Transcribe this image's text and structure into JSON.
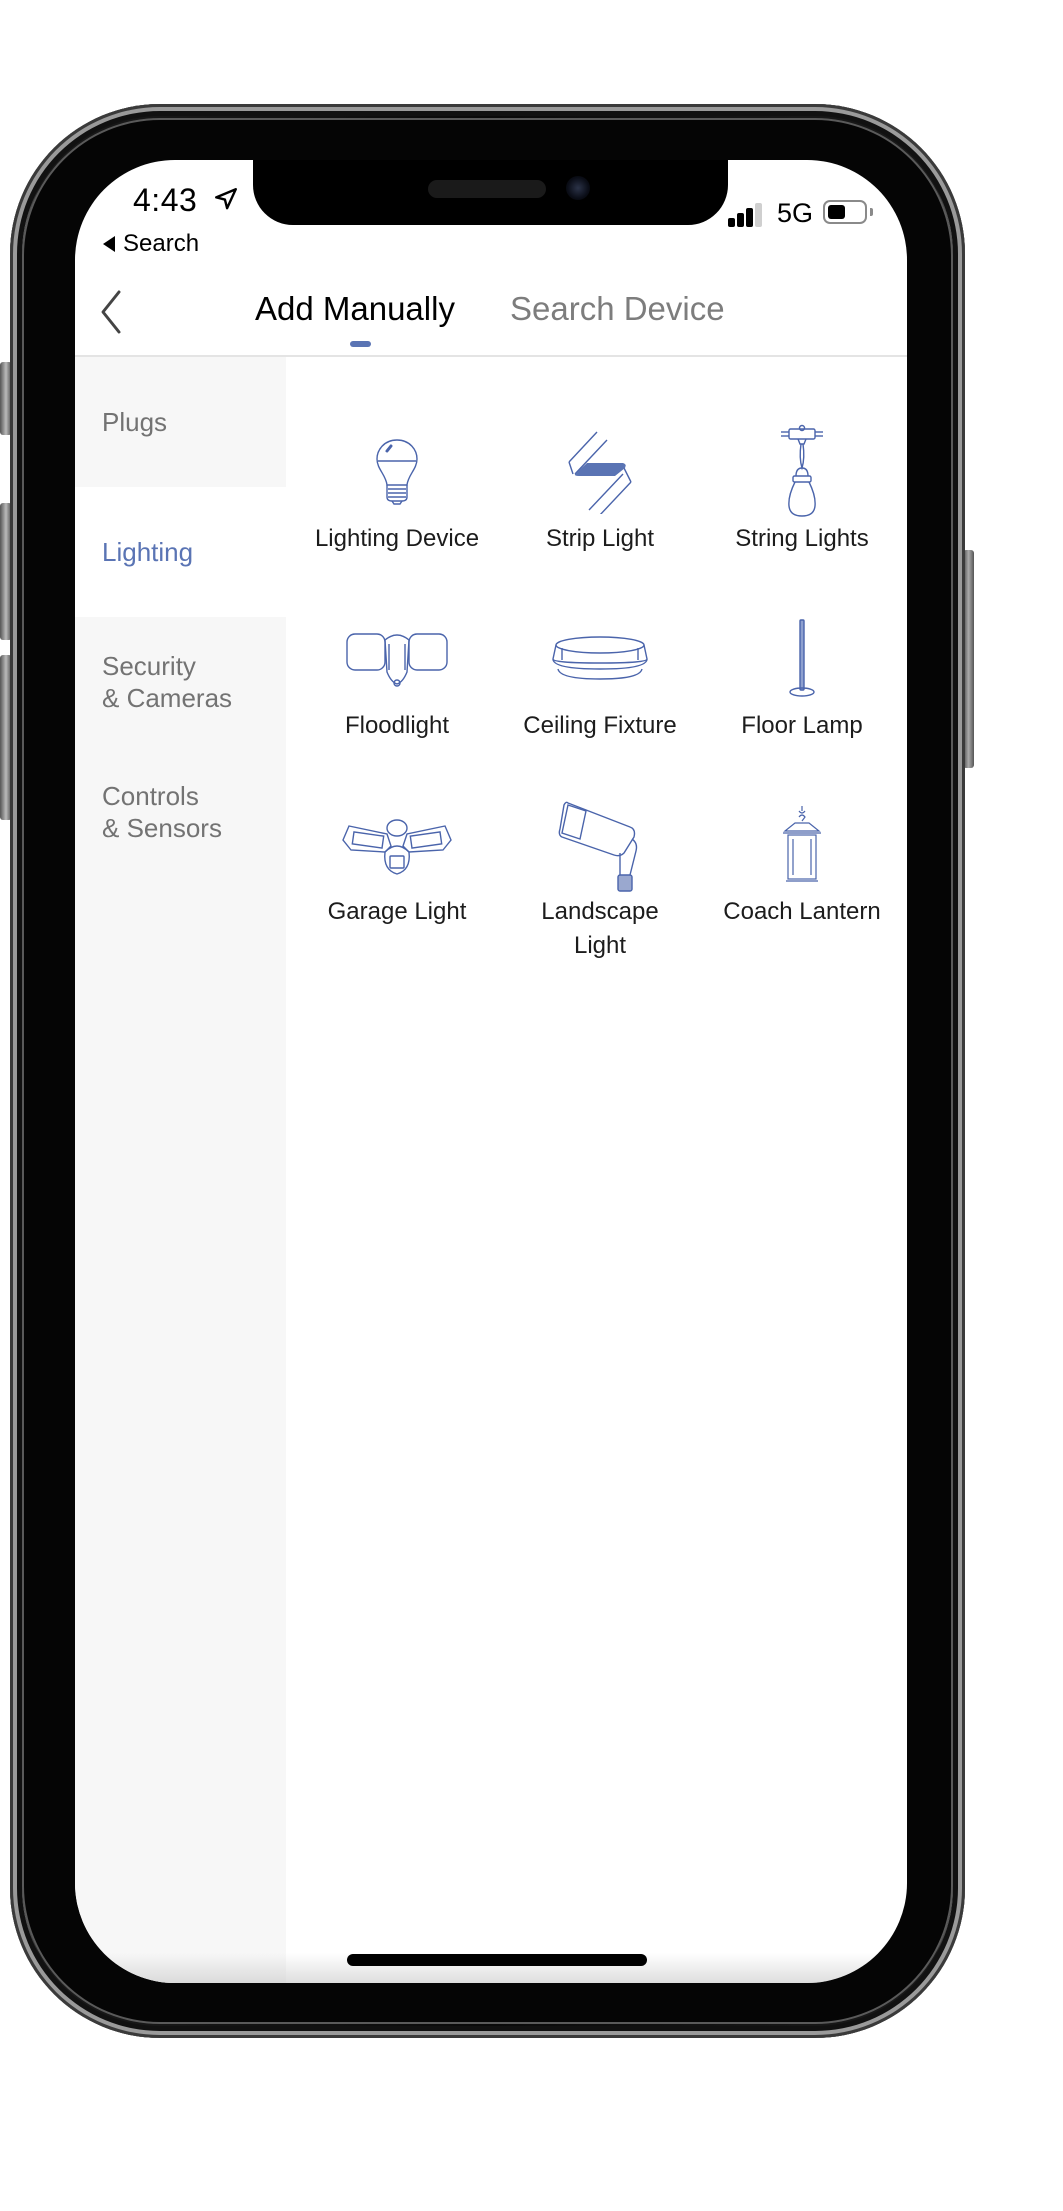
{
  "status_bar": {
    "time": "4:43",
    "back_app_label": "Search",
    "network": "5G",
    "battery_level": 0.5,
    "signal_bars_active": 3,
    "signal_bars_total": 4
  },
  "header": {
    "tabs": [
      {
        "label": "Add Manually",
        "active": true
      },
      {
        "label": "Search Device",
        "active": false
      }
    ]
  },
  "sidebar": {
    "items": [
      {
        "label": "Plugs",
        "active": false
      },
      {
        "label": "Lighting",
        "active": true
      },
      {
        "label": "Security\n& Cameras",
        "active": false
      },
      {
        "label": "Controls\n& Sensors",
        "active": false
      }
    ]
  },
  "devices": [
    {
      "label": "Lighting Device",
      "icon": "light-bulb-icon"
    },
    {
      "label": "Strip Light",
      "icon": "strip-light-icon"
    },
    {
      "label": "String Lights",
      "icon": "string-lights-icon"
    },
    {
      "label": "Floodlight",
      "icon": "floodlight-icon"
    },
    {
      "label": "Ceiling Fixture",
      "icon": "ceiling-fixture-icon"
    },
    {
      "label": "Floor Lamp",
      "icon": "floor-lamp-icon"
    },
    {
      "label": "Garage Light",
      "icon": "garage-light-icon"
    },
    {
      "label": "Landscape\nLight",
      "icon": "landscape-light-icon"
    },
    {
      "label": "Coach Lantern",
      "icon": "coach-lantern-icon"
    }
  ],
  "colors": {
    "accent": "#5a74b4",
    "icon_stroke": "#4a64ab",
    "sidebar_bg": "#f7f7f7",
    "inactive_text": "#737373"
  }
}
